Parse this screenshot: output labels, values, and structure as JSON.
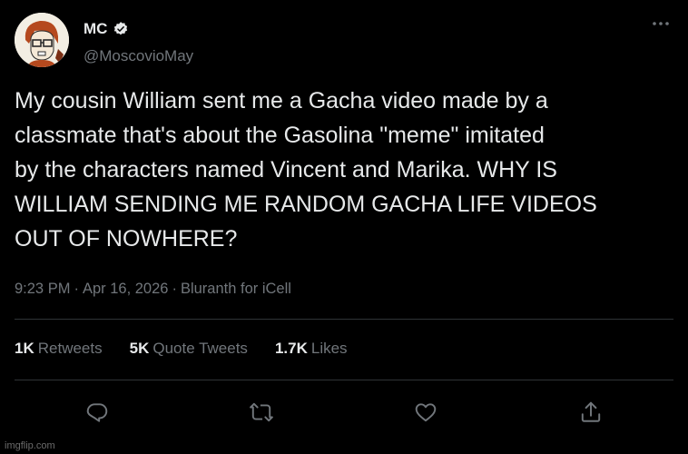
{
  "user": {
    "display_name": "MC",
    "handle": "@MoscovioMay",
    "verified": true,
    "avatar_icon": "cartoon-avatar-icon"
  },
  "tweet": {
    "text": "My cousin William sent me a Gacha video made by a\nclassmate that's about the Gasolina \"meme\" imitated\nby the characters named Vincent and Marika. WHY IS\nWILLIAM SENDING ME RANDOM GACHA LIFE VIDEOS\nOUT OF NOWHERE?"
  },
  "meta": {
    "time": "9:23 PM",
    "date": "Apr 16, 2026",
    "source": "Bluranth for iCell",
    "separator": "·"
  },
  "stats": {
    "retweets_count": "1K",
    "retweets_label": "Retweets",
    "quotes_count": "5K",
    "quotes_label": "Quote Tweets",
    "likes_count": "1.7K",
    "likes_label": "Likes"
  },
  "actions": {
    "reply_icon": "reply-icon",
    "retweet_icon": "retweet-icon",
    "like_icon": "like-icon",
    "share_icon": "share-icon"
  },
  "watermark": "imgflip.com",
  "colors": {
    "background": "#000000",
    "text": "#e7e9ea",
    "muted": "#71767b",
    "divider": "#2f3336"
  }
}
